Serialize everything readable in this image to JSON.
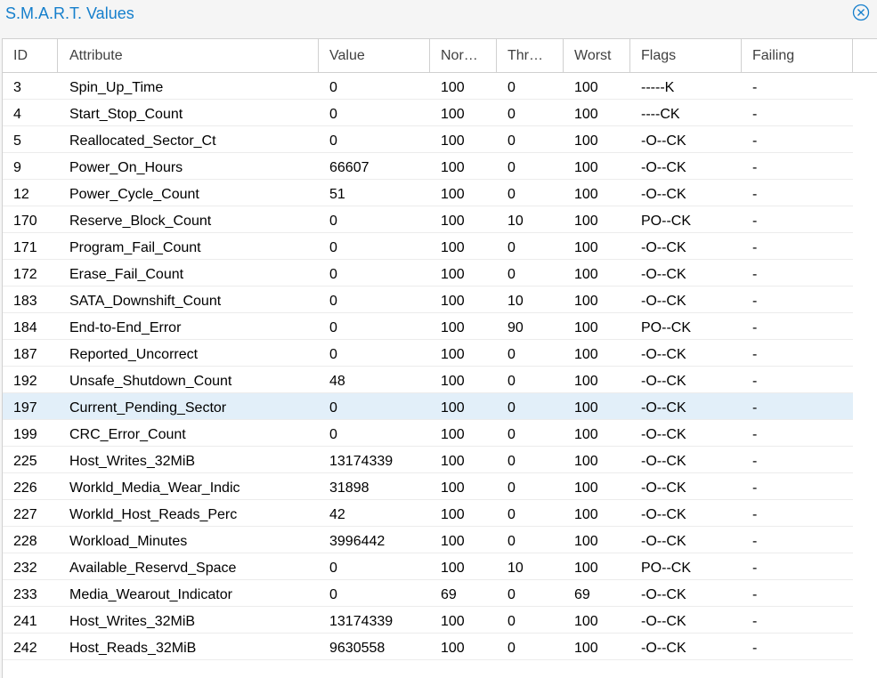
{
  "window": {
    "title": "S.M.A.R.T. Values",
    "close_icon": "close-circle-icon",
    "accent_color": "#157fcc"
  },
  "table": {
    "columns": [
      "ID",
      "Attribute",
      "Value",
      "Normalized",
      "Threshold",
      "Worst",
      "Flags",
      "Failing"
    ],
    "columns_display": [
      "ID",
      "Attribute",
      "Value",
      "Nor…",
      "Thr…",
      "Worst",
      "Flags",
      "Failing"
    ],
    "selected_row_index": 12,
    "rows": [
      [
        "3",
        "Spin_Up_Time",
        "0",
        "100",
        "0",
        "100",
        "-----K",
        "-"
      ],
      [
        "4",
        "Start_Stop_Count",
        "0",
        "100",
        "0",
        "100",
        "----CK",
        "-"
      ],
      [
        "5",
        "Reallocated_Sector_Ct",
        "0",
        "100",
        "0",
        "100",
        "-O--CK",
        "-"
      ],
      [
        "9",
        "Power_On_Hours",
        "66607",
        "100",
        "0",
        "100",
        "-O--CK",
        "-"
      ],
      [
        "12",
        "Power_Cycle_Count",
        "51",
        "100",
        "0",
        "100",
        "-O--CK",
        "-"
      ],
      [
        "170",
        "Reserve_Block_Count",
        "0",
        "100",
        "10",
        "100",
        "PO--CK",
        "-"
      ],
      [
        "171",
        "Program_Fail_Count",
        "0",
        "100",
        "0",
        "100",
        "-O--CK",
        "-"
      ],
      [
        "172",
        "Erase_Fail_Count",
        "0",
        "100",
        "0",
        "100",
        "-O--CK",
        "-"
      ],
      [
        "183",
        "SATA_Downshift_Count",
        "0",
        "100",
        "10",
        "100",
        "-O--CK",
        "-"
      ],
      [
        "184",
        "End-to-End_Error",
        "0",
        "100",
        "90",
        "100",
        "PO--CK",
        "-"
      ],
      [
        "187",
        "Reported_Uncorrect",
        "0",
        "100",
        "0",
        "100",
        "-O--CK",
        "-"
      ],
      [
        "192",
        "Unsafe_Shutdown_Count",
        "48",
        "100",
        "0",
        "100",
        "-O--CK",
        "-"
      ],
      [
        "197",
        "Current_Pending_Sector",
        "0",
        "100",
        "0",
        "100",
        "-O--CK",
        "-"
      ],
      [
        "199",
        "CRC_Error_Count",
        "0",
        "100",
        "0",
        "100",
        "-O--CK",
        "-"
      ],
      [
        "225",
        "Host_Writes_32MiB",
        "13174339",
        "100",
        "0",
        "100",
        "-O--CK",
        "-"
      ],
      [
        "226",
        "Workld_Media_Wear_Indic",
        "31898",
        "100",
        "0",
        "100",
        "-O--CK",
        "-"
      ],
      [
        "227",
        "Workld_Host_Reads_Perc",
        "42",
        "100",
        "0",
        "100",
        "-O--CK",
        "-"
      ],
      [
        "228",
        "Workload_Minutes",
        "3996442",
        "100",
        "0",
        "100",
        "-O--CK",
        "-"
      ],
      [
        "232",
        "Available_Reservd_Space",
        "0",
        "100",
        "10",
        "100",
        "PO--CK",
        "-"
      ],
      [
        "233",
        "Media_Wearout_Indicator",
        "0",
        "69",
        "0",
        "69",
        "-O--CK",
        "-"
      ],
      [
        "241",
        "Host_Writes_32MiB",
        "13174339",
        "100",
        "0",
        "100",
        "-O--CK",
        "-"
      ],
      [
        "242",
        "Host_Reads_32MiB",
        "9630558",
        "100",
        "0",
        "100",
        "-O--CK",
        "-"
      ]
    ]
  }
}
